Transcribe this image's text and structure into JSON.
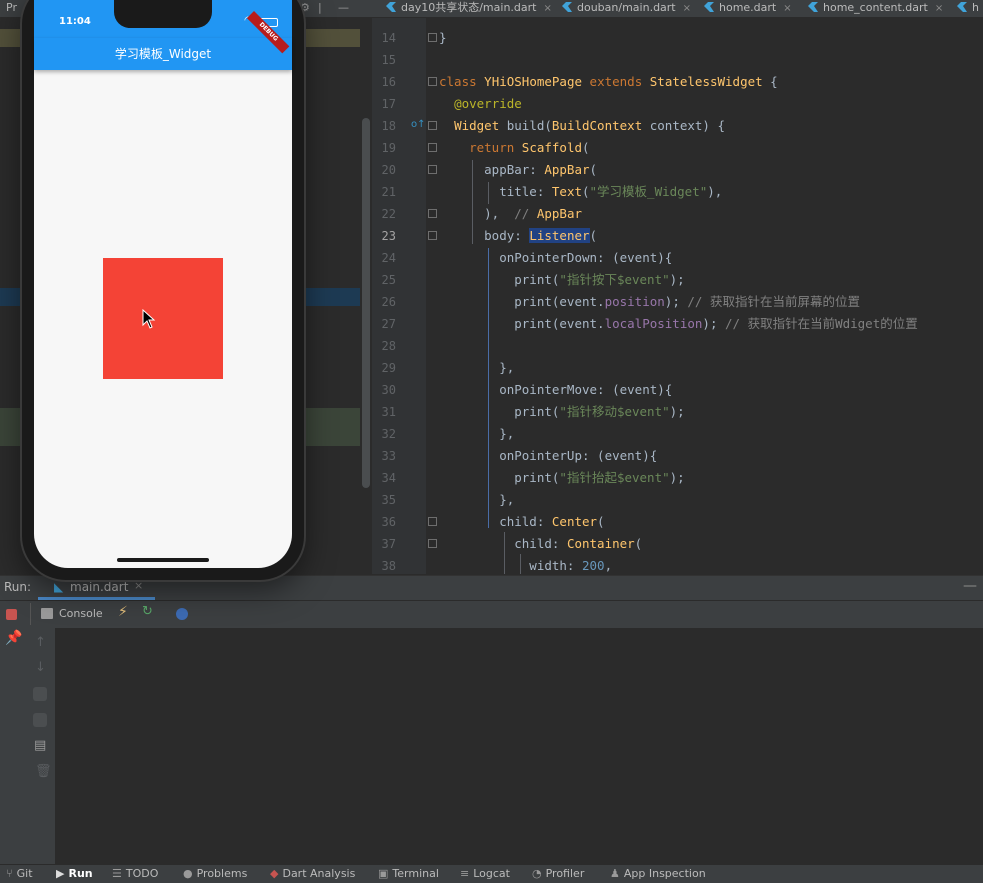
{
  "tabs": [
    {
      "label": "Pr"
    },
    {
      "label": "day10共享状态/main.dart"
    },
    {
      "label": "douban/main.dart"
    },
    {
      "label": "home.dart"
    },
    {
      "label": "home_content.dart"
    },
    {
      "label": "h"
    }
  ],
  "phone": {
    "time": "11:04",
    "banner": "DEBUG",
    "appbar_title": "学习模板_Widget",
    "box_color": "#f44336",
    "appbar_color": "#2196f3"
  },
  "editor": {
    "lines": [
      {
        "n": "14",
        "html": "}"
      },
      {
        "n": "15",
        "html": ""
      },
      {
        "n": "16",
        "html": "class YHiOSHomePage extends StatelessWidget {"
      },
      {
        "n": "17",
        "html": "  @override"
      },
      {
        "n": "18",
        "html": "  Widget build(BuildContext context) {"
      },
      {
        "n": "19",
        "html": "    return Scaffold("
      },
      {
        "n": "20",
        "html": "      appBar: AppBar("
      },
      {
        "n": "21",
        "html": "        title: Text(\"学习模板_Widget\"),"
      },
      {
        "n": "22",
        "html": "      ),  // AppBar"
      },
      {
        "n": "23",
        "html": "      body: Listener("
      },
      {
        "n": "24",
        "html": "        onPointerDown: (event){"
      },
      {
        "n": "25",
        "html": "          print(\"指针按下$event\");"
      },
      {
        "n": "26",
        "html": "          print(event.position); // 获取指针在当前屏幕的位置"
      },
      {
        "n": "27",
        "html": "          print(event.localPosition); // 获取指针在当前Wdiget的位置"
      },
      {
        "n": "28",
        "html": ""
      },
      {
        "n": "29",
        "html": "        },"
      },
      {
        "n": "30",
        "html": "        onPointerMove: (event){"
      },
      {
        "n": "31",
        "html": "          print(\"指针移动$event\");"
      },
      {
        "n": "32",
        "html": "        },"
      },
      {
        "n": "33",
        "html": "        onPointerUp: (event){"
      },
      {
        "n": "34",
        "html": "          print(\"指针抬起$event\");"
      },
      {
        "n": "35",
        "html": "        },"
      },
      {
        "n": "36",
        "html": "        child: Center("
      },
      {
        "n": "37",
        "html": "          child: Container("
      },
      {
        "n": "38",
        "html": "            width: 200,"
      }
    ],
    "current_line": "23"
  },
  "run": {
    "label": "Run:",
    "config": "main.dart",
    "console_tab": "Console"
  },
  "bottom": [
    {
      "label": "Git",
      "icon": "git-icon"
    },
    {
      "label": "Run",
      "icon": "run-icon"
    },
    {
      "label": "TODO",
      "icon": "todo-icon"
    },
    {
      "label": "Problems",
      "icon": "problems-icon"
    },
    {
      "label": "Dart Analysis",
      "icon": "dart-icon"
    },
    {
      "label": "Terminal",
      "icon": "terminal-icon"
    },
    {
      "label": "Logcat",
      "icon": "logcat-icon"
    },
    {
      "label": "Profiler",
      "icon": "profiler-icon"
    },
    {
      "label": "App Inspection",
      "icon": "inspection-icon"
    }
  ]
}
